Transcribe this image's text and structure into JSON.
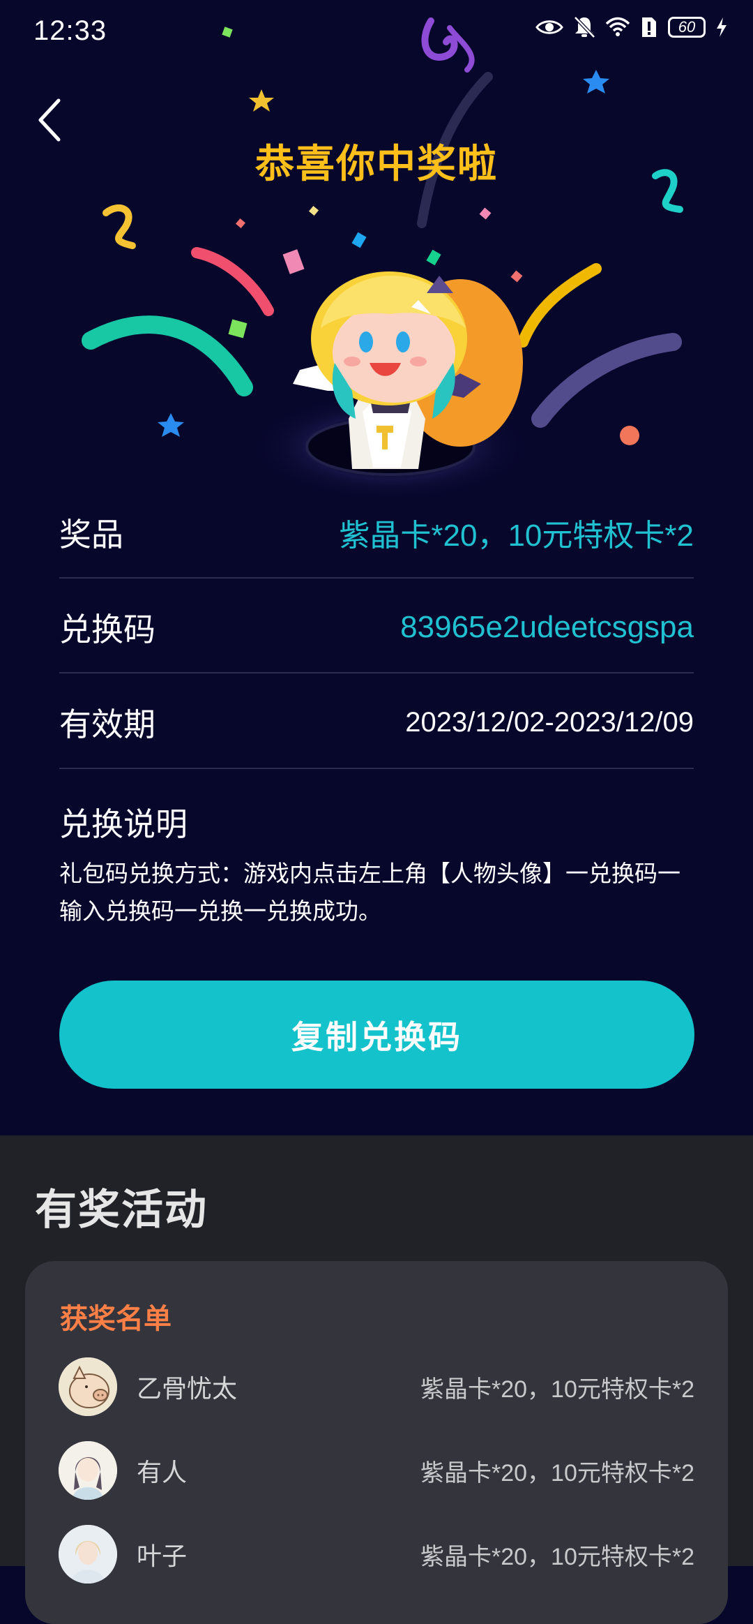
{
  "status_bar": {
    "time": "12:33",
    "battery": "60"
  },
  "header": {
    "title": "恭喜你中奖啦"
  },
  "details": {
    "prize_label": "奖品",
    "prize_value": "紫晶卡*20，10元特权卡*2",
    "code_label": "兑换码",
    "code_value": "83965e2udeetcsgspa",
    "validity_label": "有效期",
    "validity_value": "2023/12/02-2023/12/09",
    "instructions_title": "兑换说明",
    "instructions_text": "礼包码兑换方式：游戏内点击左上角【人物头像】一兑换码一输入兑换码一兑换一兑换成功。"
  },
  "copy_button": {
    "label": "复制兑换码"
  },
  "activities": {
    "title": "有奖活动",
    "winners_title": "获奖名单",
    "winners": [
      {
        "name": "乙骨忧太",
        "prize": "紫晶卡*20，10元特权卡*2"
      },
      {
        "name": "有人",
        "prize": "紫晶卡*20，10元特权卡*2"
      },
      {
        "name": "叶子",
        "prize": "紫晶卡*20，10元特权卡*2"
      }
    ]
  },
  "colors": {
    "background": "#07062b",
    "accent_gold": "#ffbf1a",
    "teal": "#13c2cb",
    "winners_orange": "#ff8047"
  }
}
